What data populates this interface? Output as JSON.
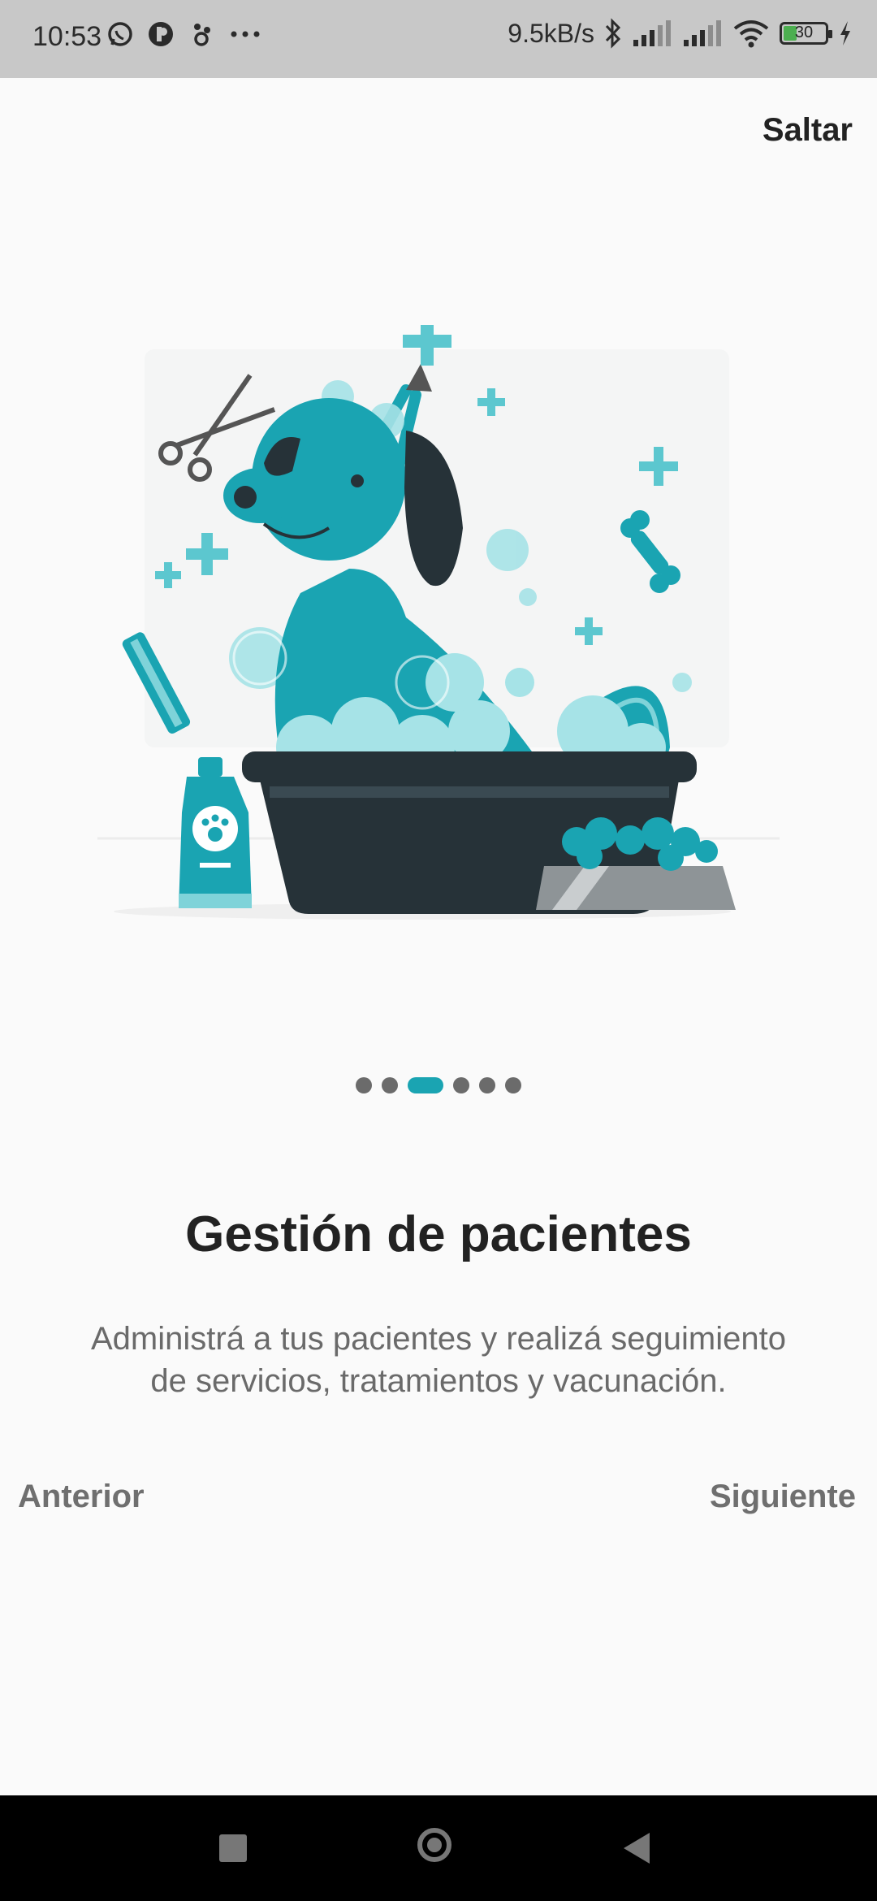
{
  "status_bar": {
    "time": "10:53",
    "speed": "9.5kB/s",
    "battery_level": "30",
    "battery_fraction": 0.3,
    "left_icons": [
      "whatsapp-icon",
      "app-icon",
      "notification-icon",
      "more-dots-icon"
    ],
    "right_icons": [
      "bluetooth-icon",
      "signal-icon",
      "signal-icon",
      "wifi-icon",
      "battery-icon",
      "charging-icon"
    ]
  },
  "header": {
    "skip_label": "Saltar"
  },
  "onboarding": {
    "title": "Gestión de pacientes",
    "description": "Administrá a tus pacientes y realizá seguimiento de servicios, tratamientos y vacunación.",
    "page_count": 6,
    "current_page": 3,
    "illustration": "dog-bath-illustration"
  },
  "footer": {
    "prev_label": "Anterior",
    "next_label": "Siguiente"
  },
  "colors": {
    "accent": "#1aa4b2",
    "dark": "#263238",
    "dot_inactive": "#6b6b6b"
  },
  "system_nav": [
    "recents-button",
    "home-button",
    "back-button"
  ]
}
